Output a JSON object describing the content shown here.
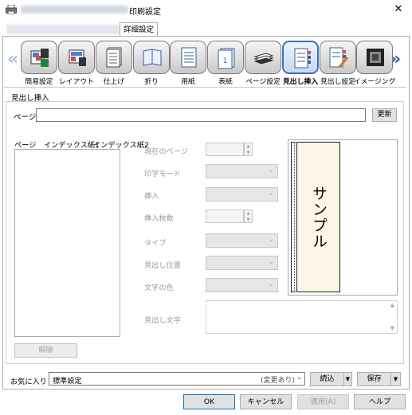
{
  "window": {
    "title": "印刷設定",
    "close_glyph": "✕"
  },
  "tabs": {
    "detail": "詳細設定"
  },
  "toolbar": {
    "items": [
      {
        "label": "簡易設定",
        "icon": "easy-setting-icon"
      },
      {
        "label": "レイアウト",
        "icon": "layout-icon"
      },
      {
        "label": "仕上げ",
        "icon": "finishing-icon"
      },
      {
        "label": "折り",
        "icon": "fold-icon"
      },
      {
        "label": "用紙",
        "icon": "paper-icon"
      },
      {
        "label": "表紙",
        "icon": "cover-icon"
      },
      {
        "label": "ページ設定",
        "icon": "page-setting-icon"
      },
      {
        "label": "見出し挿入",
        "icon": "tab-insert-icon",
        "active": true
      },
      {
        "label": "見出し設定",
        "icon": "tab-setting-icon"
      },
      {
        "label": "イメージング",
        "icon": "imaging-icon"
      }
    ],
    "prev_glyph": "«",
    "next_glyph": "»"
  },
  "section": {
    "title": "見出し挿入",
    "page_label": "ページ",
    "page_value": "",
    "update_button": "更新",
    "list_headers": [
      "ページ",
      "インデックス紙1",
      "インデックス紙2"
    ],
    "delete_button": "解除",
    "fields": {
      "current_page": "現在のページ",
      "print_mode": "印字モード",
      "insert": "挿入",
      "insert_count": "挿入枚数",
      "type": "タイプ",
      "heading_position": "見出し位置",
      "text_color": "文字の色",
      "heading_text": "見出し文字"
    },
    "preview_text": "サンプル"
  },
  "favorites": {
    "label": "お気に入り",
    "value": "標準設定",
    "changed": "(変更あり)",
    "load_button": "読込",
    "save_button": "保存"
  },
  "dialog_buttons": {
    "ok": "OK",
    "cancel": "キャンセル",
    "apply": "適用(A)",
    "help": "ヘルプ"
  },
  "colors": {
    "accent": "#3a6fc2",
    "nav_next": "#2a63b6",
    "nav_prev_disabled": "#a9bfd9"
  }
}
